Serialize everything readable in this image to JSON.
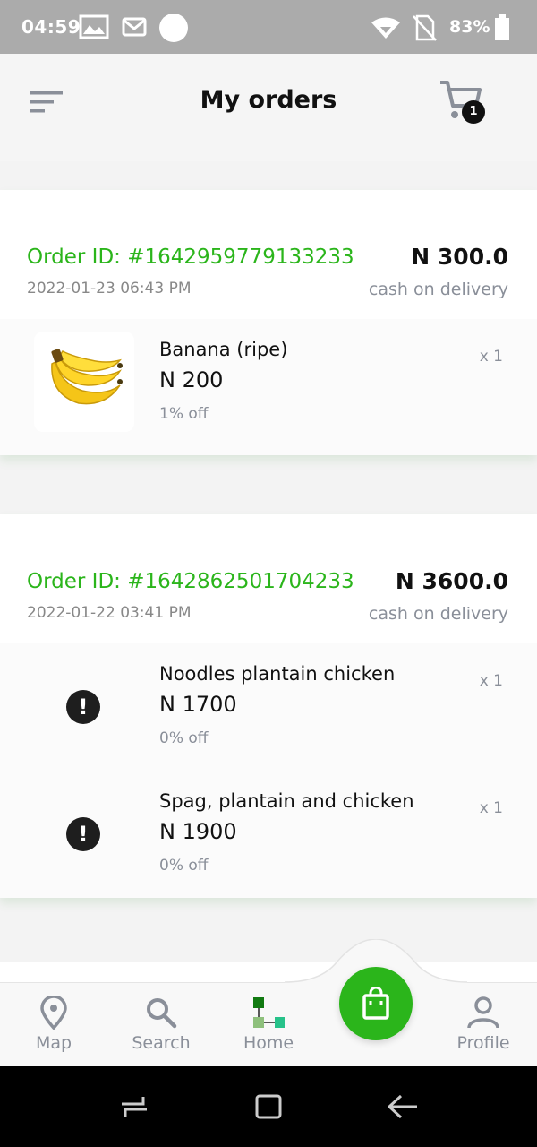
{
  "status_bar": {
    "time": "04:59",
    "battery": "83%",
    "icons": [
      "gallery-icon",
      "gmail-icon",
      "circle-icon",
      "wifi-icon",
      "no-sim-icon",
      "battery-icon"
    ]
  },
  "header": {
    "title": "My orders",
    "cart_count": "1",
    "icons": [
      "menu-icon",
      "cart-icon"
    ]
  },
  "orders": [
    {
      "id": "Order ID: #1642959779133233",
      "date": "2022-01-23 06:43 PM",
      "total": "N 300.0",
      "payment": "cash on delivery",
      "items": [
        {
          "name": "Banana (ripe)",
          "price": "N 200",
          "discount": "1% off",
          "qty": "x 1",
          "thumb": "banana-image"
        }
      ]
    },
    {
      "id": "Order ID: #1642862501704233",
      "date": "2022-01-22 03:41 PM",
      "total": "N 3600.0",
      "payment": "cash on delivery",
      "items": [
        {
          "name": "Noodles plantain chicken",
          "price": "N 1700",
          "discount": "0% off",
          "qty": "x 1",
          "thumb": "alert-icon"
        },
        {
          "name": "Spag, plantain and chicken",
          "price": "N 1900",
          "discount": "0% off",
          "qty": "x 1",
          "thumb": "alert-icon"
        }
      ]
    }
  ],
  "bottom_nav": {
    "items": [
      {
        "label": "Map",
        "icon": "map-pin-icon"
      },
      {
        "label": "Search",
        "icon": "search-icon"
      },
      {
        "label": "Home",
        "icon": "home-icon"
      },
      {
        "label": "",
        "icon": "shopping-bag-icon"
      },
      {
        "label": "Profile",
        "icon": "profile-icon"
      }
    ]
  },
  "colors": {
    "accent": "#2bb51b",
    "status_bar": "#ababab",
    "muted_text": "#8a8f99"
  }
}
